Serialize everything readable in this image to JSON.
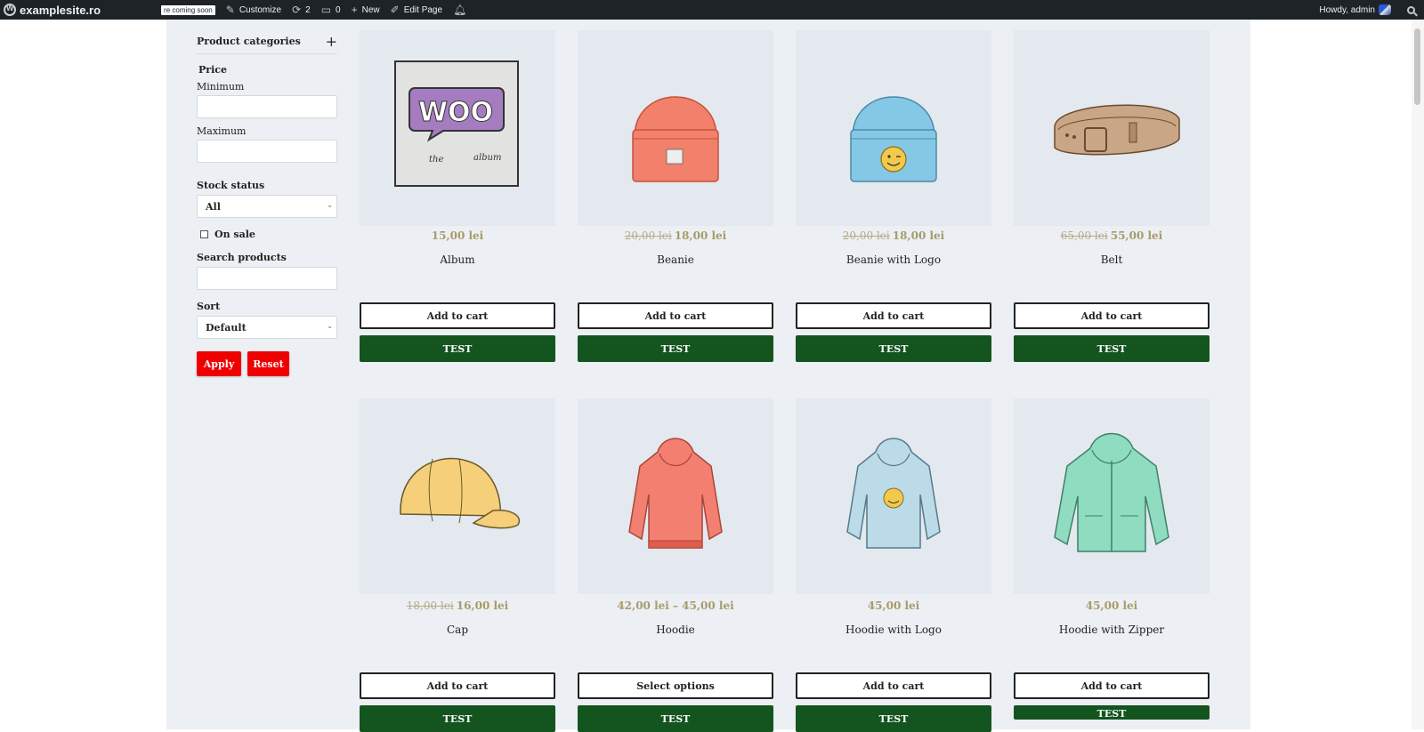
{
  "adminbar": {
    "site_name": "examplesite.ro",
    "coming_soon": "re coming soon",
    "customize": "Customize",
    "updates_count": "2",
    "comments_count": "0",
    "new_label": "New",
    "edit_page": "Edit Page",
    "howdy": "Howdy, admin"
  },
  "sidebar": {
    "categories_title": "Product categories",
    "price_title": "Price",
    "min_label": "Minimum",
    "max_label": "Maximum",
    "stock_title": "Stock status",
    "stock_value": "All",
    "on_sale_label": "On sale",
    "search_title": "Search products",
    "sort_title": "Sort",
    "sort_value": "Default",
    "apply_label": "Apply",
    "reset_label": "Reset"
  },
  "products": [
    {
      "name": "Album",
      "old_price": "",
      "price": "15,00 lei",
      "button": "Add to cart",
      "test": "TEST"
    },
    {
      "name": "Beanie",
      "old_price": "20,00 lei",
      "price": "18,00 lei",
      "button": "Add to cart",
      "test": "TEST"
    },
    {
      "name": "Beanie with Logo",
      "old_price": "20,00 lei",
      "price": "18,00 lei",
      "button": "Add to cart",
      "test": "TEST"
    },
    {
      "name": "Belt",
      "old_price": "65,00 lei",
      "price": "55,00 lei",
      "button": "Add to cart",
      "test": "TEST"
    },
    {
      "name": "Cap",
      "old_price": "18,00 lei",
      "price": "16,00 lei",
      "button": "Add to cart",
      "test": "TEST"
    },
    {
      "name": "Hoodie",
      "old_price": "",
      "price": "42,00 lei – 45,00 lei",
      "button": "Select options",
      "test": "TEST"
    },
    {
      "name": "Hoodie with Logo",
      "old_price": "",
      "price": "45,00 lei",
      "button": "Add to cart",
      "test": "TEST"
    },
    {
      "name": "Hoodie with Zipper",
      "old_price": "",
      "price": "45,00 lei",
      "button": "Add to cart",
      "test": "TEST"
    }
  ],
  "album_art": {
    "logo": "WOO",
    "caption_1": "the",
    "caption_2": "album"
  },
  "colors": {
    "accent_green": "#13541f",
    "button_red": "#ee0000",
    "price_gold": "#a89b6a",
    "panel_bg": "#eceff3"
  }
}
